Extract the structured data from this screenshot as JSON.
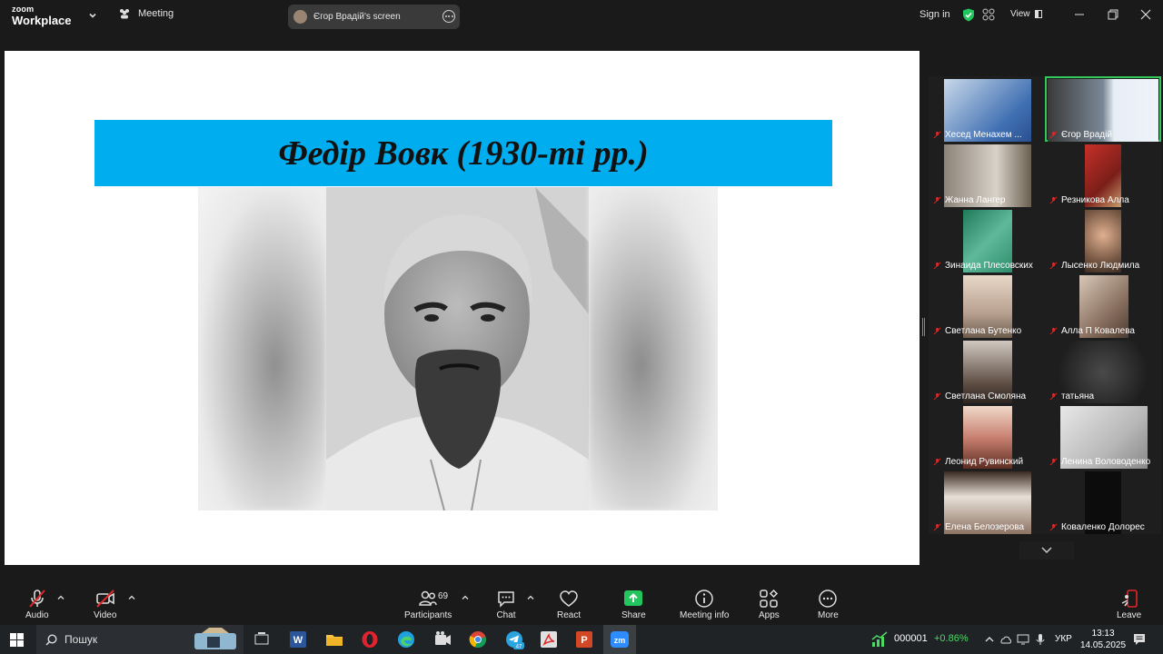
{
  "app": {
    "brand_top": "zoom",
    "brand_bottom": "Workplace",
    "meeting_label": "Meeting",
    "screen_share_label": "Єгор Врадій's screen",
    "signin_label": "Sign in",
    "view_label": "View"
  },
  "slide": {
    "title": "Федір Вовк  (1930-ті рр.)",
    "title_bg": "#00aeef"
  },
  "gallery": {
    "participants": [
      {
        "name": "Хесед Менахем ..."
      },
      {
        "name": "Єгор Врадій",
        "active": true
      },
      {
        "name": "Жанна Лангер"
      },
      {
        "name": "Резникова Алла"
      },
      {
        "name": "Зинаида Плесовских"
      },
      {
        "name": "Лысенко Людмила"
      },
      {
        "name": "Светлана Бутенко"
      },
      {
        "name": "Алла П Ковалева"
      },
      {
        "name": "Светлана Смоляна"
      },
      {
        "name": "татьяна"
      },
      {
        "name": "Леонид Рувинский"
      },
      {
        "name": "Ленина Воловоденко"
      },
      {
        "name": "Елена Белозерова"
      },
      {
        "name": "Коваленко Долорес"
      }
    ]
  },
  "toolbar": {
    "audio": "Audio",
    "video": "Video",
    "participants": "Participants",
    "participants_count": "69",
    "chat": "Chat",
    "react": "React",
    "share": "Share",
    "meeting_info": "Meeting info",
    "apps": "Apps",
    "more": "More",
    "leave": "Leave"
  },
  "taskbar": {
    "search_placeholder": "Пошук",
    "stock_value": "000001",
    "stock_change": "+0.86%",
    "language": "УКР",
    "time": "13:13",
    "date": "14.05.2025",
    "telegram_badge": "47"
  },
  "colors": {
    "accent_green": "#34c759",
    "share_green": "#22c55e",
    "mute_red": "#e02828"
  }
}
